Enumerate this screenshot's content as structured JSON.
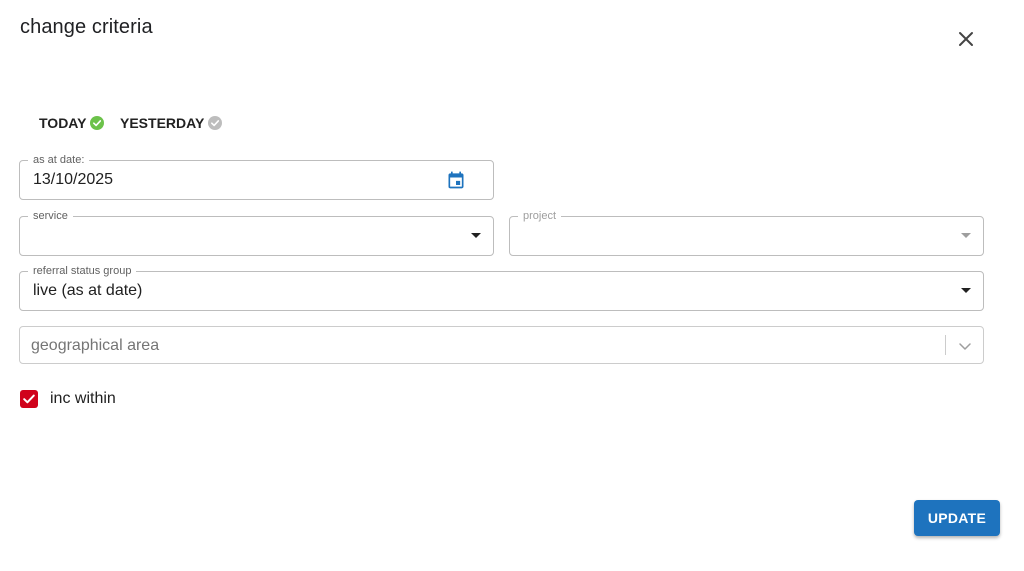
{
  "dialog": {
    "title": "change criteria"
  },
  "icons": {
    "close": "close-icon",
    "today_check": "check-circle-icon",
    "yesterday_check": "check-circle-icon",
    "calendar": "calendar-icon",
    "dropdown": "caret-down-icon",
    "chevron": "chevron-down-icon"
  },
  "colors": {
    "primary": "#1e73be",
    "success": "#6cc24a",
    "inactive": "#bdbdbd",
    "checkbox": "#d0021b"
  },
  "quick_dates": {
    "today": {
      "label": "TODAY",
      "selected": true
    },
    "yesterday": {
      "label": "YESTERDAY",
      "selected": false
    }
  },
  "as_at_date": {
    "label": "as at date:",
    "value": "13/10/2025"
  },
  "service": {
    "label": "service",
    "value": ""
  },
  "project": {
    "label": "project",
    "value": "",
    "disabled": true
  },
  "referral_status_group": {
    "label": "referral status group",
    "value": "live (as at date)"
  },
  "geographical_area": {
    "placeholder": "geographical area",
    "value": ""
  },
  "inc_within": {
    "label": "inc within",
    "checked": true
  },
  "actions": {
    "update": "UPDATE"
  }
}
